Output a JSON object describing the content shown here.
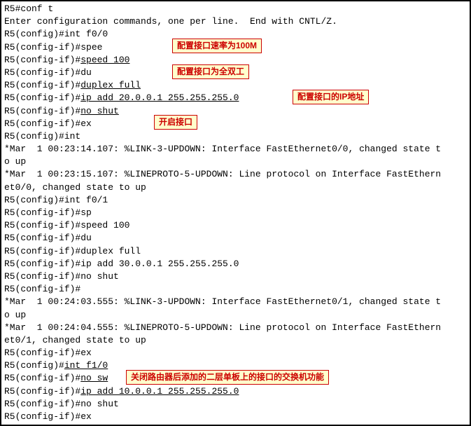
{
  "lines": {
    "l1": "R5#conf t",
    "l2": "Enter configuration commands, one per line.  End with CNTL/Z.",
    "l3": "R5(config)#int f0/0",
    "l4": "R5(config-if)#spee",
    "l5p": "R5(config-if)#",
    "l5u": "speed 100",
    "l6": "R5(config-if)#du",
    "l7p": "R5(config-if)#",
    "l7u": "duplex full",
    "l8p": "R5(config-if)#",
    "l8u": "ip add 20.0.0.1 255.255.255.0",
    "l9p": "R5(config-if)#",
    "l9u": "no shut",
    "l10": "R5(config-if)#ex",
    "l11": "R5(config)#int",
    "l12": "*Mar  1 00:23:14.107: %LINK-3-UPDOWN: Interface FastEthernet0/0, changed state t",
    "l13": "o up",
    "l14": "*Mar  1 00:23:15.107: %LINEPROTO-5-UPDOWN: Line protocol on Interface FastEthern",
    "l15": "et0/0, changed state to up",
    "l16": "R5(config)#int f0/1",
    "l17": "R5(config-if)#sp",
    "l18": "R5(config-if)#speed 100",
    "l19": "R5(config-if)#du",
    "l20": "R5(config-if)#duplex full",
    "l21": "R5(config-if)#ip add 30.0.0.1 255.255.255.0",
    "l22": "R5(config-if)#no shut",
    "l23": "R5(config-if)#",
    "l24": "*Mar  1 00:24:03.555: %LINK-3-UPDOWN: Interface FastEthernet0/1, changed state t",
    "l25": "o up",
    "l26": "*Mar  1 00:24:04.555: %LINEPROTO-5-UPDOWN: Line protocol on Interface FastEthern",
    "l27": "et0/1, changed state to up",
    "l28": "R5(config-if)#ex",
    "l29p": "R5(config)#",
    "l29u": "int f1/0",
    "l30p": "R5(config-if)#",
    "l30u": "no sw",
    "l31p": "R5(config-if)#",
    "l31u": "ip add 10.0.0.1 255.255.255.0",
    "l32": "R5(config-if)#no shut",
    "l33": "R5(config-if)#ex"
  },
  "annotations": {
    "a1": "配置接口速率为100M",
    "a2": "配置接口为全双工",
    "a3": "配置接口的IP地址",
    "a4": "开启接口",
    "a5": "关闭路由器后添加的二层单板上的接口的交换机功能"
  }
}
